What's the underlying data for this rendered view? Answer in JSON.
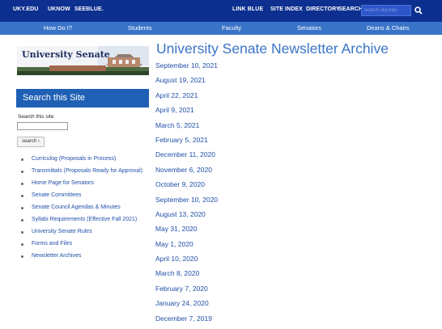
{
  "topbar": {
    "links": [
      "UKY.EDU",
      "UKNOW",
      "SEEBLUE.",
      "LINK BLUE",
      "SITE INDEX",
      "DIRECTORY",
      "SEARCH"
    ],
    "search_placeholder": "search uky.edu"
  },
  "navbar": {
    "items": [
      "How Do I?",
      "Students",
      "Faculty",
      "Senators",
      "Deans & Chairs"
    ]
  },
  "sidebar": {
    "logo_text": "University Senate",
    "search_heading": "Search this Site",
    "search_label": "Search this site",
    "search_button": "search ›",
    "links": [
      "Curriculog (Proposals in Process)",
      "Transmittals (Proposals Ready for Approval)",
      "Home Page for Senators",
      "Senate Committees",
      "Senate Council Agendas & Minutes",
      "Syllabi Requirements (Effective Fall 2021)",
      "University Senate Rules",
      "Forms and Files",
      "Newsletter Archives"
    ]
  },
  "main": {
    "title": "University Senate Newsletter Archive",
    "newsletters": [
      "September 10, 2021",
      "August 19, 2021",
      "April 22, 2021",
      "April 9, 2021",
      "March 5, 2021",
      "February 5, 2021",
      "December 11, 2020",
      "November 6, 2020",
      "October 9, 2020",
      "September 10, 2020",
      "August 13, 2020",
      "May 31, 2020",
      "May 1, 2020",
      "April 10, 2020",
      "March 8, 2020",
      "February 7, 2020",
      "January 24, 2020",
      "December 7, 2019"
    ]
  },
  "colors": {
    "topbar": "#0d2f8f",
    "navbar": "#3a74c8",
    "link": "#1f4fa8",
    "search_box": "#1f60b5"
  },
  "icons": {
    "search_submit": "magnifier-icon"
  }
}
